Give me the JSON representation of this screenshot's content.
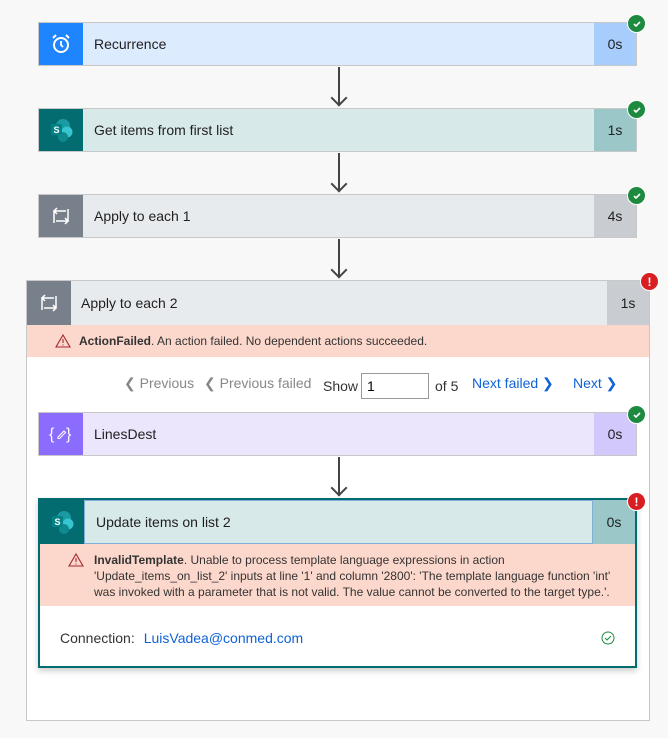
{
  "steps": [
    {
      "title": "Recurrence",
      "duration": "0s",
      "icon": "alarm-clock-icon",
      "status": "succeeded"
    },
    {
      "title": "Get items from first list",
      "duration": "1s",
      "icon": "sharepoint-icon",
      "status": "succeeded"
    },
    {
      "title": "Apply to each 1",
      "duration": "4s",
      "icon": "loop-icon",
      "status": "succeeded"
    }
  ],
  "loop": {
    "title": "Apply to each 2",
    "duration": "1s",
    "icon": "loop-icon",
    "status": "failed",
    "error_code": "ActionFailed",
    "error_message": ". An action failed. No dependent actions succeeded.",
    "pager": {
      "previous": "Previous",
      "previous_failed": "Previous failed",
      "show_label": "Show",
      "current": "1",
      "of_label": "of 5",
      "next_failed": "Next failed",
      "next": "Next"
    },
    "children": [
      {
        "title": "LinesDest",
        "duration": "0s",
        "icon": "variable-icon",
        "status": "succeeded"
      },
      {
        "title": "Update items on list 2",
        "duration": "0s",
        "icon": "sharepoint-icon",
        "status": "failed",
        "error_code": "InvalidTemplate",
        "error_message": ". Unable to process template language expressions in action 'Update_items_on_list_2' inputs at line '1' and column '2800': 'The template language function 'int' was invoked with a parameter that is not valid. The value cannot be converted to the target type.'.",
        "connection_label": "Connection:",
        "connection_value": "LuisVadea@conmed.com"
      }
    ]
  },
  "colors": {
    "recurrence": "#1f85ff",
    "sharepoint": "#036c70",
    "loop": "#78808c",
    "variable": "#8c6cff",
    "success": "#1e8a3f",
    "error": "#d81e23",
    "link": "#0f62d6"
  }
}
